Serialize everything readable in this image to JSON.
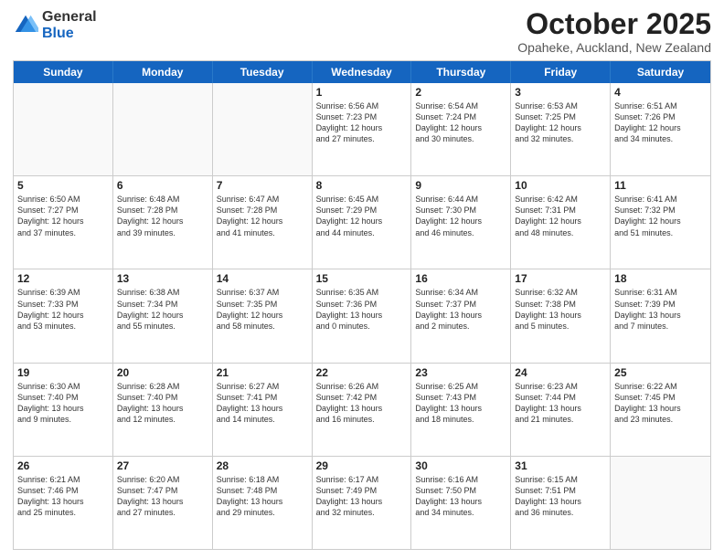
{
  "logo": {
    "general": "General",
    "blue": "Blue"
  },
  "title": "October 2025",
  "location": "Opaheke, Auckland, New Zealand",
  "days": [
    "Sunday",
    "Monday",
    "Tuesday",
    "Wednesday",
    "Thursday",
    "Friday",
    "Saturday"
  ],
  "weeks": [
    [
      {
        "day": "",
        "info": ""
      },
      {
        "day": "",
        "info": ""
      },
      {
        "day": "",
        "info": ""
      },
      {
        "day": "1",
        "info": "Sunrise: 6:56 AM\nSunset: 7:23 PM\nDaylight: 12 hours\nand 27 minutes."
      },
      {
        "day": "2",
        "info": "Sunrise: 6:54 AM\nSunset: 7:24 PM\nDaylight: 12 hours\nand 30 minutes."
      },
      {
        "day": "3",
        "info": "Sunrise: 6:53 AM\nSunset: 7:25 PM\nDaylight: 12 hours\nand 32 minutes."
      },
      {
        "day": "4",
        "info": "Sunrise: 6:51 AM\nSunset: 7:26 PM\nDaylight: 12 hours\nand 34 minutes."
      }
    ],
    [
      {
        "day": "5",
        "info": "Sunrise: 6:50 AM\nSunset: 7:27 PM\nDaylight: 12 hours\nand 37 minutes."
      },
      {
        "day": "6",
        "info": "Sunrise: 6:48 AM\nSunset: 7:28 PM\nDaylight: 12 hours\nand 39 minutes."
      },
      {
        "day": "7",
        "info": "Sunrise: 6:47 AM\nSunset: 7:28 PM\nDaylight: 12 hours\nand 41 minutes."
      },
      {
        "day": "8",
        "info": "Sunrise: 6:45 AM\nSunset: 7:29 PM\nDaylight: 12 hours\nand 44 minutes."
      },
      {
        "day": "9",
        "info": "Sunrise: 6:44 AM\nSunset: 7:30 PM\nDaylight: 12 hours\nand 46 minutes."
      },
      {
        "day": "10",
        "info": "Sunrise: 6:42 AM\nSunset: 7:31 PM\nDaylight: 12 hours\nand 48 minutes."
      },
      {
        "day": "11",
        "info": "Sunrise: 6:41 AM\nSunset: 7:32 PM\nDaylight: 12 hours\nand 51 minutes."
      }
    ],
    [
      {
        "day": "12",
        "info": "Sunrise: 6:39 AM\nSunset: 7:33 PM\nDaylight: 12 hours\nand 53 minutes."
      },
      {
        "day": "13",
        "info": "Sunrise: 6:38 AM\nSunset: 7:34 PM\nDaylight: 12 hours\nand 55 minutes."
      },
      {
        "day": "14",
        "info": "Sunrise: 6:37 AM\nSunset: 7:35 PM\nDaylight: 12 hours\nand 58 minutes."
      },
      {
        "day": "15",
        "info": "Sunrise: 6:35 AM\nSunset: 7:36 PM\nDaylight: 13 hours\nand 0 minutes."
      },
      {
        "day": "16",
        "info": "Sunrise: 6:34 AM\nSunset: 7:37 PM\nDaylight: 13 hours\nand 2 minutes."
      },
      {
        "day": "17",
        "info": "Sunrise: 6:32 AM\nSunset: 7:38 PM\nDaylight: 13 hours\nand 5 minutes."
      },
      {
        "day": "18",
        "info": "Sunrise: 6:31 AM\nSunset: 7:39 PM\nDaylight: 13 hours\nand 7 minutes."
      }
    ],
    [
      {
        "day": "19",
        "info": "Sunrise: 6:30 AM\nSunset: 7:40 PM\nDaylight: 13 hours\nand 9 minutes."
      },
      {
        "day": "20",
        "info": "Sunrise: 6:28 AM\nSunset: 7:40 PM\nDaylight: 13 hours\nand 12 minutes."
      },
      {
        "day": "21",
        "info": "Sunrise: 6:27 AM\nSunset: 7:41 PM\nDaylight: 13 hours\nand 14 minutes."
      },
      {
        "day": "22",
        "info": "Sunrise: 6:26 AM\nSunset: 7:42 PM\nDaylight: 13 hours\nand 16 minutes."
      },
      {
        "day": "23",
        "info": "Sunrise: 6:25 AM\nSunset: 7:43 PM\nDaylight: 13 hours\nand 18 minutes."
      },
      {
        "day": "24",
        "info": "Sunrise: 6:23 AM\nSunset: 7:44 PM\nDaylight: 13 hours\nand 21 minutes."
      },
      {
        "day": "25",
        "info": "Sunrise: 6:22 AM\nSunset: 7:45 PM\nDaylight: 13 hours\nand 23 minutes."
      }
    ],
    [
      {
        "day": "26",
        "info": "Sunrise: 6:21 AM\nSunset: 7:46 PM\nDaylight: 13 hours\nand 25 minutes."
      },
      {
        "day": "27",
        "info": "Sunrise: 6:20 AM\nSunset: 7:47 PM\nDaylight: 13 hours\nand 27 minutes."
      },
      {
        "day": "28",
        "info": "Sunrise: 6:18 AM\nSunset: 7:48 PM\nDaylight: 13 hours\nand 29 minutes."
      },
      {
        "day": "29",
        "info": "Sunrise: 6:17 AM\nSunset: 7:49 PM\nDaylight: 13 hours\nand 32 minutes."
      },
      {
        "day": "30",
        "info": "Sunrise: 6:16 AM\nSunset: 7:50 PM\nDaylight: 13 hours\nand 34 minutes."
      },
      {
        "day": "31",
        "info": "Sunrise: 6:15 AM\nSunset: 7:51 PM\nDaylight: 13 hours\nand 36 minutes."
      },
      {
        "day": "",
        "info": ""
      }
    ]
  ]
}
